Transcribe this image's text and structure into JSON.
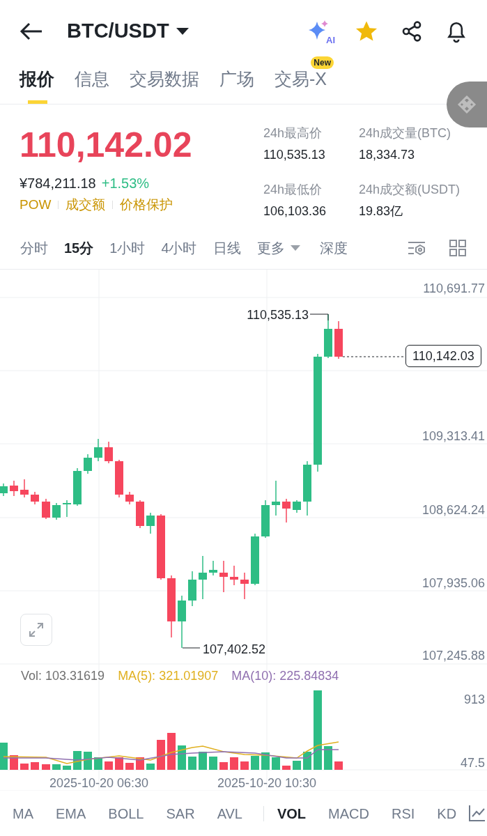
{
  "header": {
    "title": "BTC/USDT",
    "ai_label": "AI"
  },
  "tabs": [
    {
      "label": "报价",
      "selected": true
    },
    {
      "label": "信息",
      "selected": false
    },
    {
      "label": "交易数据",
      "selected": false
    },
    {
      "label": "广场",
      "selected": false
    },
    {
      "label": "交易-X",
      "selected": false,
      "badge": "New"
    }
  ],
  "price": {
    "last": "110,142.02",
    "cny": "¥784,211.18",
    "change": "+1.53%",
    "tags": [
      "POW",
      "成交额",
      "价格保护"
    ]
  },
  "stats": [
    {
      "label": "24h最高价",
      "value": "110,535.13"
    },
    {
      "label": "24h成交量(BTC)",
      "value": "18,334.73"
    },
    {
      "label": "24h最低价",
      "value": "106,103.36"
    },
    {
      "label": "24h成交额(USDT)",
      "value": "19.83亿"
    }
  ],
  "intervals": [
    {
      "label": "分时",
      "selected": false
    },
    {
      "label": "15分",
      "selected": true
    },
    {
      "label": "1小时",
      "selected": false
    },
    {
      "label": "4小时",
      "selected": false
    },
    {
      "label": "日线",
      "selected": false
    }
  ],
  "more": "更多",
  "depth": "深度",
  "chart": {
    "price_ticks": [
      "110,691.77",
      "109,313.41",
      "108,624.24",
      "107,935.06",
      "107,245.88"
    ],
    "high_label": "110,535.13",
    "low_label": "107,402.52",
    "current_label": "110,142.03"
  },
  "volume": {
    "legend": [
      {
        "text": "Vol: 103.31619",
        "color": "#707070"
      },
      {
        "text": "MA(5): 321.01907",
        "color": "#e0b020"
      },
      {
        "text": "MA(10): 225.84834",
        "color": "#9070b0"
      }
    ],
    "ticks": [
      "913",
      "47.5"
    ],
    "dates": [
      "2025-10-20 06:30",
      "2025-10-20 10:30"
    ]
  },
  "indicators": [
    {
      "label": "MA",
      "selected": false
    },
    {
      "label": "EMA",
      "selected": false
    },
    {
      "label": "BOLL",
      "selected": false
    },
    {
      "label": "SAR",
      "selected": false
    },
    {
      "label": "AVL",
      "selected": false
    },
    {
      "label": "VOL",
      "selected": true
    },
    {
      "label": "MACD",
      "selected": false
    },
    {
      "label": "RSI",
      "selected": false
    },
    {
      "label": "KD",
      "selected": false
    }
  ]
}
